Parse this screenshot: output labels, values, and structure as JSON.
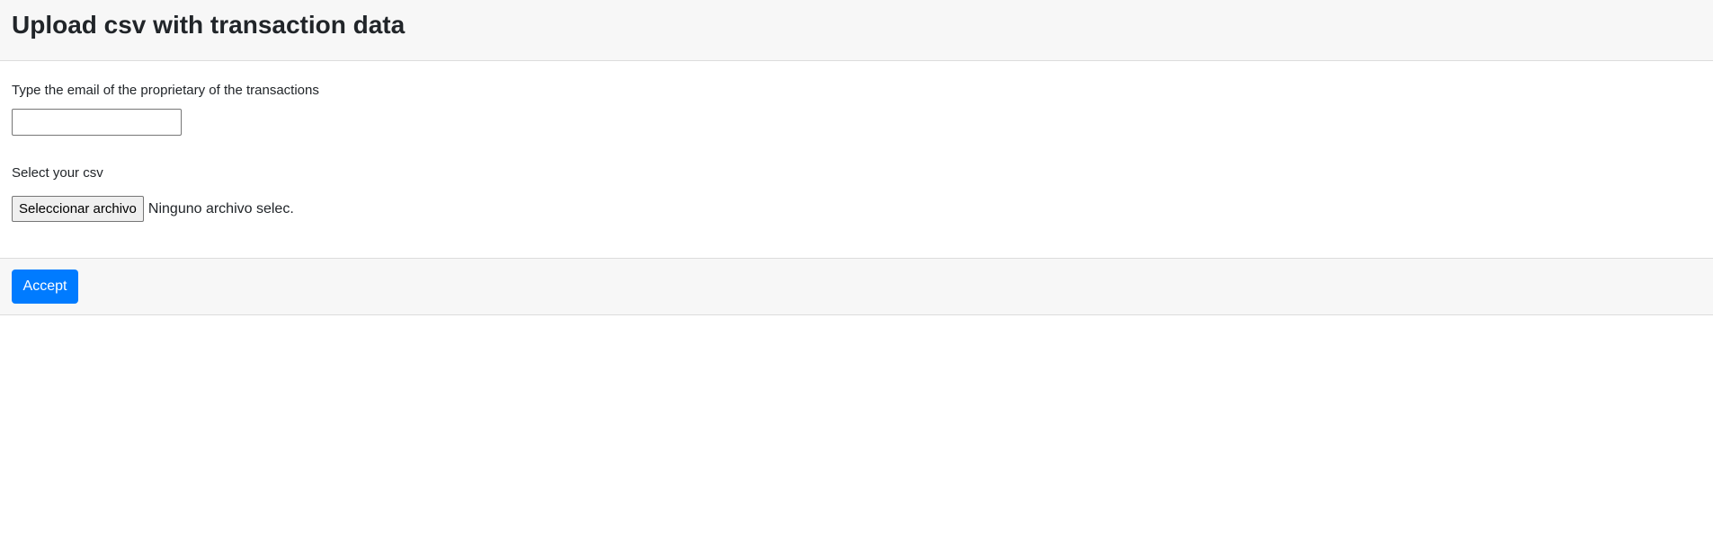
{
  "header": {
    "title": "Upload csv with transaction data"
  },
  "form": {
    "email_label": "Type the email of the proprietary of the transactions",
    "email_value": "",
    "csv_label": "Select your csv",
    "file_button_label": "Seleccionar archivo",
    "file_status": "Ninguno archivo selec."
  },
  "footer": {
    "accept_label": "Accept"
  },
  "colors": {
    "accent": "#007bff",
    "header_bg": "#f7f7f7"
  }
}
